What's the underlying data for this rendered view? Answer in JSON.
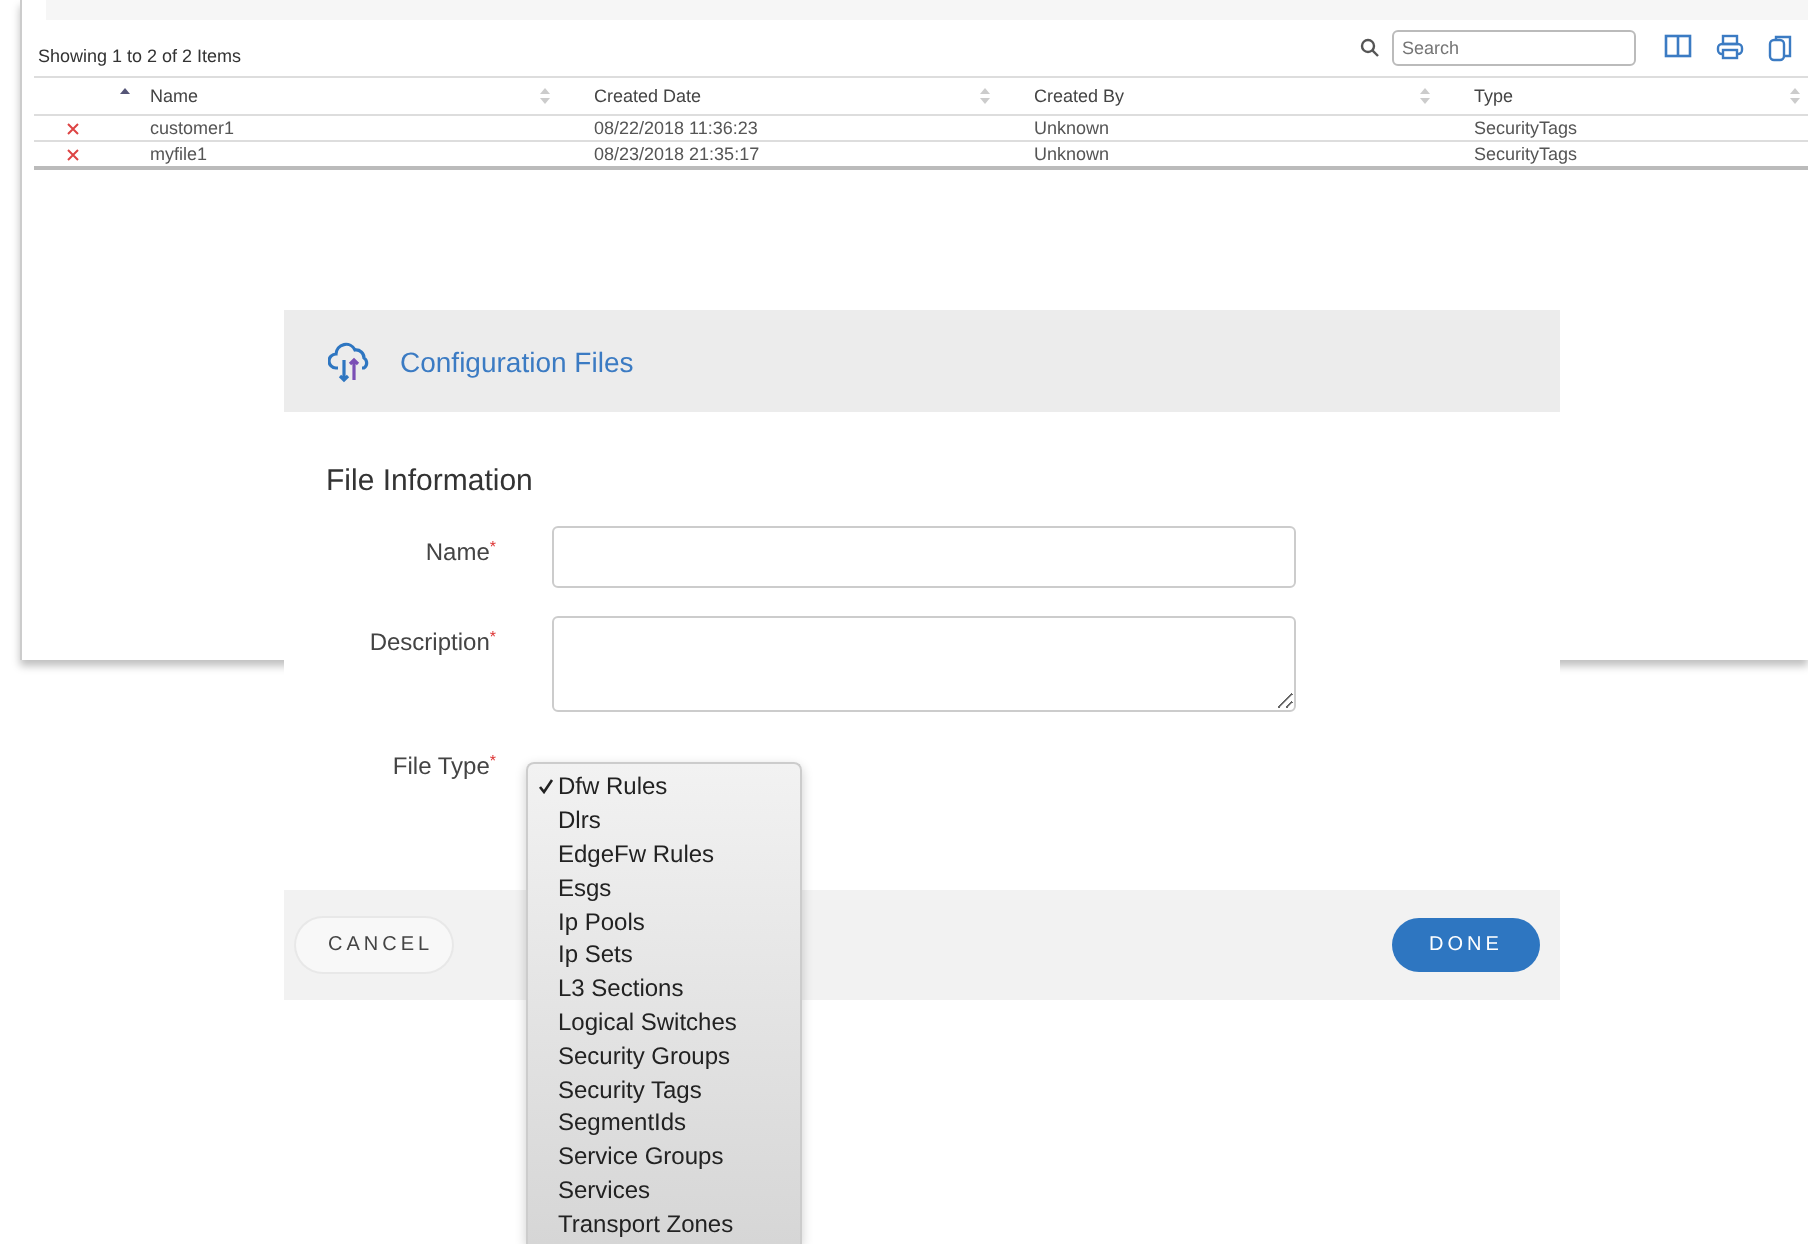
{
  "list": {
    "summary": "Showing 1 to 2 of 2 Items",
    "search": {
      "placeholder": "Search"
    },
    "columns": [
      {
        "label": "Name",
        "sorted": true
      },
      {
        "label": "Created Date",
        "sorted": false
      },
      {
        "label": "Created By",
        "sorted": false
      },
      {
        "label": "Type",
        "sorted": false
      }
    ],
    "rows": [
      {
        "cells": [
          "customer1",
          "08/22/2018 11:36:23",
          "Unknown",
          "SecurityTags"
        ]
      },
      {
        "cells": [
          "myfile1",
          "08/23/2018 21:35:17",
          "Unknown",
          "SecurityTags"
        ]
      }
    ]
  },
  "dialog": {
    "title": "Configuration Files",
    "section": "File Information",
    "fields": [
      {
        "label": "Name",
        "required_mark": "*",
        "kind": "text"
      },
      {
        "label": "Description",
        "required_mark": "*",
        "kind": "textarea"
      },
      {
        "label": "File Type",
        "required_mark": "*",
        "kind": "select"
      }
    ],
    "options": [
      {
        "label": "Dfw Rules",
        "selected": true
      },
      {
        "label": "Dlrs",
        "selected": false
      },
      {
        "label": "EdgeFw Rules",
        "selected": false
      },
      {
        "label": "Esgs",
        "selected": false
      },
      {
        "label": "Ip Pools",
        "selected": false
      },
      {
        "label": "Ip Sets",
        "selected": false
      },
      {
        "label": "L3 Sections",
        "selected": false
      },
      {
        "label": "Logical Switches",
        "selected": false
      },
      {
        "label": "Security Groups",
        "selected": false
      },
      {
        "label": "Security Tags",
        "selected": false
      },
      {
        "label": "SegmentIds",
        "selected": false
      },
      {
        "label": "Service Groups",
        "selected": false
      },
      {
        "label": "Services",
        "selected": false
      },
      {
        "label": "Transport Zones",
        "selected": false
      }
    ],
    "buttons": [
      {
        "label": "CANCEL",
        "kind": "secondary"
      },
      {
        "label": "DONE",
        "kind": "primary"
      }
    ]
  }
}
